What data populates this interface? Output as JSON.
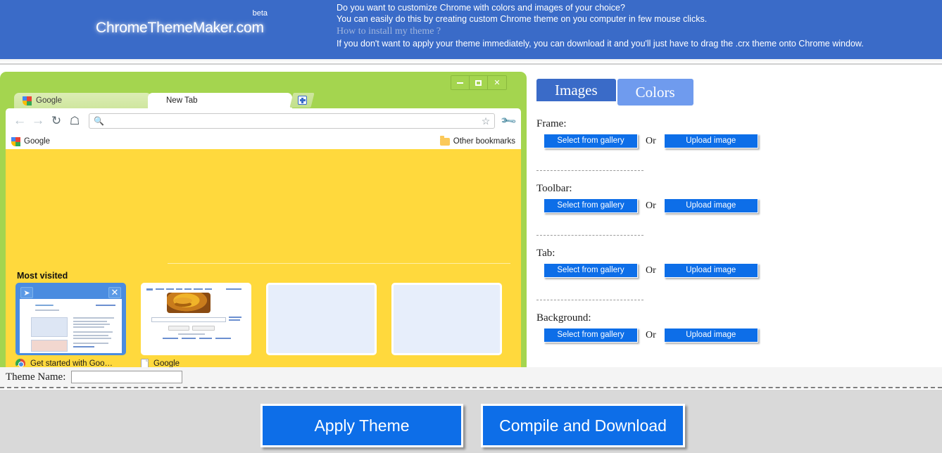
{
  "header": {
    "logo": "ChromeThemeMaker.com",
    "beta": "beta",
    "line1": "Do you want to customize Chrome with colors and images of your choice?",
    "line2": "You can easily do this by creating custom Chrome theme on you computer in few mouse clicks.",
    "howto_link": "How to install my theme ?",
    "line4": "If you don't want to apply your theme immediately, you can download it and you'll just have to drag the .crx theme onto Chrome window.",
    "bg_color": "#3a6bc8",
    "link_color": "#9fb4dd"
  },
  "preview": {
    "frame_color": "#a4d54f",
    "toolbar_color": "#ffffff",
    "background_color": "#ffd93d",
    "window_controls": {
      "minimize": "minimize",
      "maximize": "maximize",
      "close": "✕"
    },
    "tabs": [
      {
        "label": "Google",
        "state": "inactive"
      },
      {
        "label": "New Tab",
        "state": "active"
      }
    ],
    "new_tab_button": "+",
    "omnibox": {
      "value": "",
      "placeholder": ""
    },
    "bookmarks": {
      "items": [
        {
          "label": "Google"
        }
      ],
      "other": "Other bookmarks"
    },
    "ntp": {
      "title": "Most visited",
      "tiles": [
        {
          "label": "Get started with Goo…",
          "icon": "chrome-icon",
          "kind": "chrome-welcome",
          "selected": true
        },
        {
          "label": "Google",
          "icon": "page-icon",
          "kind": "google-home",
          "selected": false
        },
        {
          "label": "",
          "icon": "",
          "kind": "empty",
          "selected": false
        },
        {
          "label": "",
          "icon": "",
          "kind": "empty",
          "selected": false
        },
        {
          "label": "",
          "icon": "",
          "kind": "empty",
          "selected": false
        },
        {
          "label": "",
          "icon": "",
          "kind": "empty",
          "selected": false
        },
        {
          "label": "",
          "icon": "",
          "kind": "empty",
          "selected": false
        },
        {
          "label": "",
          "icon": "",
          "kind": "empty",
          "selected": false
        }
      ]
    }
  },
  "panel": {
    "tabs": [
      {
        "label": "Images",
        "active": true
      },
      {
        "label": "Colors",
        "active": false
      }
    ],
    "active_color": "#3a6bc8",
    "inactive_color": "#6f9bee",
    "or_label": "Or",
    "sections": [
      {
        "label": "Frame:",
        "gallery": "Select from gallery",
        "upload": "Upload image"
      },
      {
        "label": "Toolbar:",
        "gallery": "Select from gallery",
        "upload": "Upload image"
      },
      {
        "label": "Tab:",
        "gallery": "Select from gallery",
        "upload": "Upload image"
      },
      {
        "label": "Background:",
        "gallery": "Select from gallery",
        "upload": "Upload image"
      }
    ]
  },
  "theme_name": {
    "label": "Theme Name:",
    "value": "",
    "placeholder": ""
  },
  "footer": {
    "apply": "Apply Theme",
    "compile": "Compile and Download",
    "button_color": "#0d6ee8",
    "bg_color": "#d9d9d9"
  }
}
